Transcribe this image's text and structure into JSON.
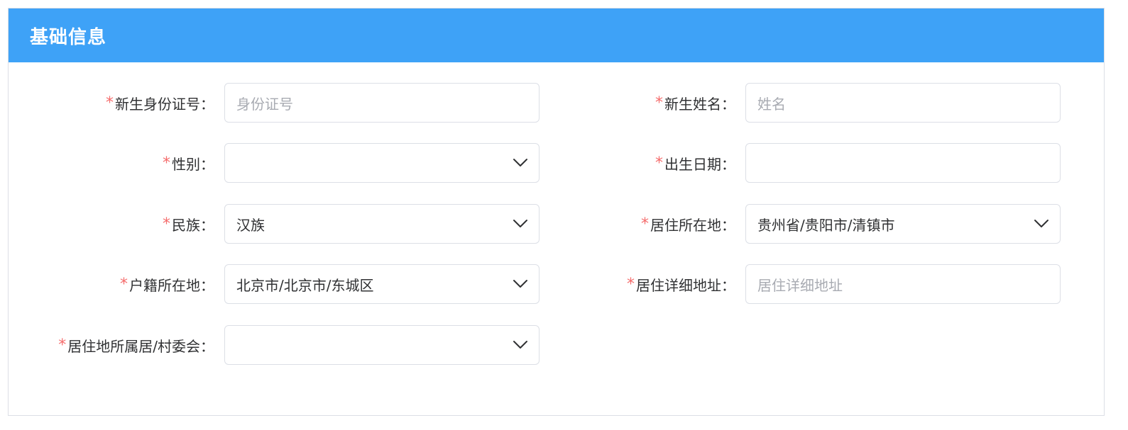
{
  "panel": {
    "title": "基础信息",
    "header_color": "#3ea2f7"
  },
  "required_mark": "*",
  "form": {
    "id_number": {
      "label": "新生身份证号：",
      "placeholder": "身份证号",
      "value": ""
    },
    "name": {
      "label": "新生姓名：",
      "placeholder": "姓名",
      "value": ""
    },
    "gender": {
      "label": "性别：",
      "value": "",
      "icon": "chevron-down-icon"
    },
    "birth_date": {
      "label": "出生日期：",
      "value": ""
    },
    "ethnicity": {
      "label": "民族：",
      "value": "汉族",
      "icon": "chevron-down-icon"
    },
    "residence_location": {
      "label": "居住所在地：",
      "value": "贵州省/贵阳市/清镇市",
      "icon": "chevron-down-icon"
    },
    "household_location": {
      "label": "户籍所在地：",
      "value": "北京市/北京市/东城区",
      "icon": "chevron-down-icon"
    },
    "residence_address": {
      "label": "居住详细地址：",
      "placeholder": "居住详细地址",
      "value": ""
    },
    "residence_committee": {
      "label": "居住地所属居/村委会：",
      "value": "",
      "icon": "chevron-down-icon"
    }
  }
}
